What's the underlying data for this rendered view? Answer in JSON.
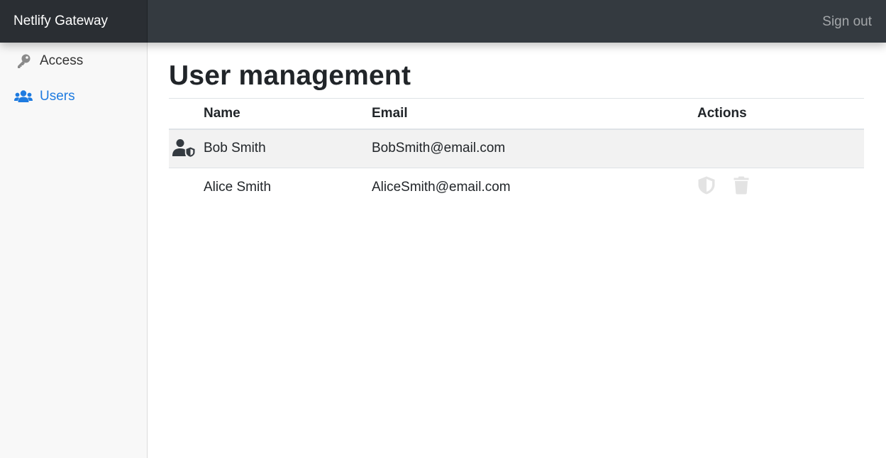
{
  "app": {
    "brand": "Netlify Gateway",
    "sign_out": "Sign out"
  },
  "sidebar": {
    "items": [
      {
        "label": "Access",
        "icon": "key-icon",
        "active": false
      },
      {
        "label": "Users",
        "icon": "users-icon",
        "active": true
      }
    ]
  },
  "main": {
    "title": "User management",
    "table": {
      "columns": [
        "",
        "Name",
        "Email",
        "Actions"
      ],
      "rows": [
        {
          "name": "Bob Smith",
          "email": "BobSmith@email.com",
          "role_icon": "user-shield-icon",
          "actions": []
        },
        {
          "name": "Alice Smith",
          "email": "AliceSmith@email.com",
          "role_icon": "",
          "actions": [
            "shield-icon",
            "trash-icon"
          ]
        }
      ]
    }
  },
  "colors": {
    "topbar": "#343a40",
    "brand_bg": "#2a2e33",
    "accent": "#1e7be0",
    "sidebar_bg": "#f8f8f8",
    "row_highlight": "#f2f2f2",
    "disabled_icon": "#e3e3e3"
  }
}
